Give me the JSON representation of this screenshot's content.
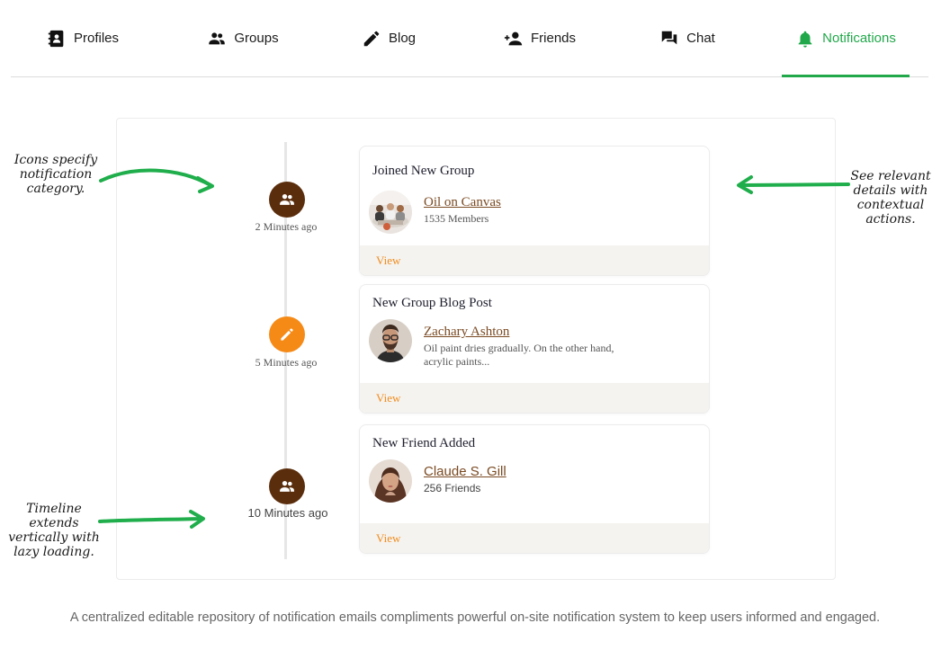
{
  "nav": {
    "tabs": [
      {
        "label": "Profiles",
        "icon": "contact-book-icon"
      },
      {
        "label": "Groups",
        "icon": "group-icon"
      },
      {
        "label": "Blog",
        "icon": "pencil-icon"
      },
      {
        "label": "Friends",
        "icon": "add-person-icon"
      },
      {
        "label": "Chat",
        "icon": "chat-bubbles-icon"
      },
      {
        "label": "Notifications",
        "icon": "bell-icon",
        "active": true
      }
    ]
  },
  "colors": {
    "accent": "#21a84a",
    "node_brown": "#5a2d0c",
    "node_orange": "#f58a17",
    "link_brown": "#7a4a22",
    "view_orange": "#f08c1e"
  },
  "timeline": [
    {
      "time": "2 Minutes ago",
      "icon": "group-icon",
      "color": "#5a2d0c"
    },
    {
      "time": "5 Minutes ago",
      "icon": "pencil-icon",
      "color": "#f58a17"
    },
    {
      "time": "10 Minutes ago",
      "icon": "group-icon",
      "color": "#5a2d0c"
    }
  ],
  "cards": [
    {
      "title": "Joined New Group",
      "link": "Oil on Canvas",
      "sub": "1535 Members",
      "action": "View"
    },
    {
      "title": "New Group Blog Post",
      "link": "Zachary Ashton",
      "sub": "Oil paint dries gradually. On the other hand, acrylic paints...",
      "action": "View"
    },
    {
      "title": "New Friend Added",
      "link": "Claude S. Gill",
      "sub": "256 Friends",
      "action": "View"
    }
  ],
  "annotations": {
    "icons": "Icons specify notification category.",
    "details": "See relevant details with contextual actions.",
    "timeline": "Timeline extends vertically with lazy loading."
  },
  "footer": "A centralized editable repository of notification emails compliments powerful on-site notification system to keep users informed and engaged."
}
